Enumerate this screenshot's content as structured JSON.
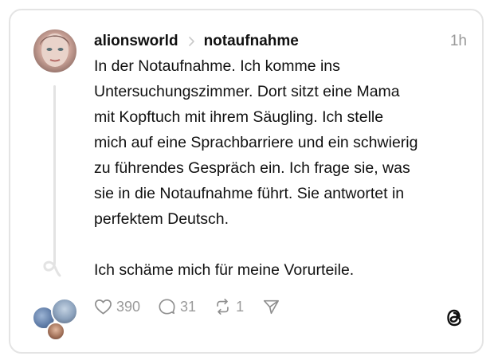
{
  "post": {
    "username": "alionsworld",
    "topic": "notaufnahme",
    "time": "1h",
    "paragraphs": [
      "In der Notaufnahme. Ich komme ins\nUntersuchungszimmer. Dort sitzt eine Mama\nmit Kopftuch mit ihrem Säugling. Ich stelle\nmich auf eine Sprachbarriere und ein schwierig\nzu führendes Gespräch ein. Ich frage sie, was\nsie in die Notaufnahme führt. Sie antwortet in\nperfektem Deutsch.",
      "Ich schäme mich für meine Vorurteile."
    ]
  },
  "actions": {
    "likes": "390",
    "replies": "31",
    "reposts": "1"
  },
  "icons": {
    "like": "heart-icon",
    "reply": "comment-icon",
    "repost": "repost-icon",
    "share": "send-icon",
    "chevron": "chevron-right-icon",
    "logo": "threads-logo-icon"
  },
  "colors": {
    "text": "#101010",
    "muted": "#999999",
    "border": "#e4e4e4"
  }
}
